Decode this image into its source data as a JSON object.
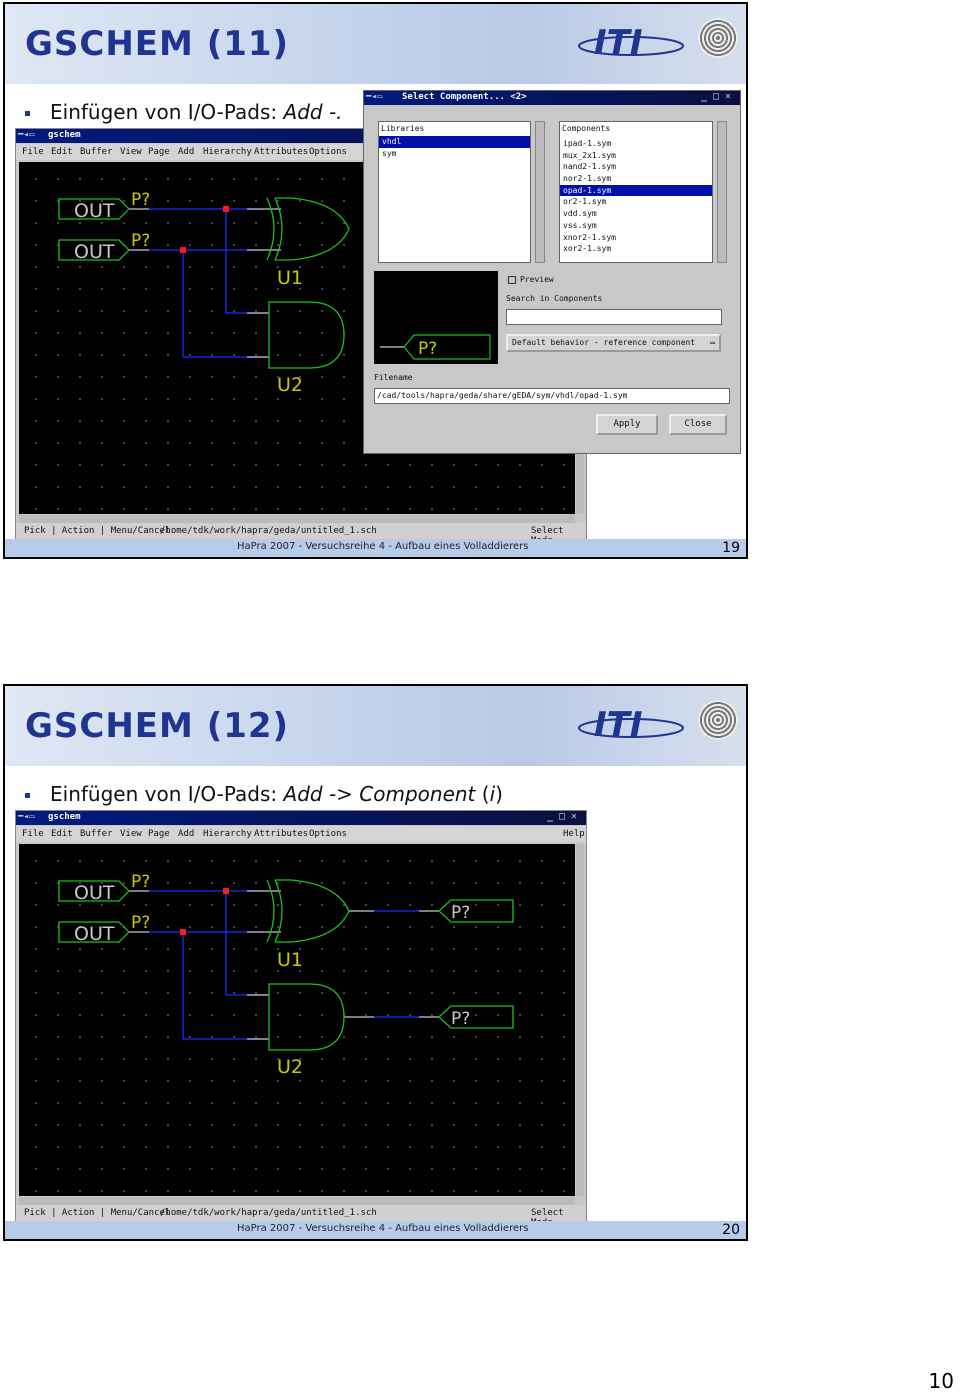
{
  "slides": [
    {
      "title": "GSCHEM (11)",
      "bullet": {
        "text": "Einfügen von I/O-Pads: ",
        "italic": "Add -."
      },
      "footer": "HaPra 2007 - Versuchsreihe 4 - Aufbau eines Volladdierers",
      "page": "19"
    },
    {
      "title": "GSCHEM (12)",
      "bullet": {
        "text": "Einfügen von I/O-Pads: ",
        "italic": "Add -> Component",
        "suffix": " (",
        "suffix_italic": "i",
        "suffix_end": ")"
      },
      "footer": "HaPra 2007 - Versuchsreihe 4 - Aufbau eines Volladdierers",
      "page": "20"
    }
  ],
  "logo": {
    "text": "ITI"
  },
  "gschem": {
    "title": "gschem",
    "menu": [
      "File",
      "Edit",
      "Buffer",
      "View",
      "Page",
      "Add",
      "Hierarchy",
      "Attributes",
      "Options",
      "Help"
    ],
    "status_left": "Pick  | Action  | Menu/Cancel",
    "status_path": "/home/tdk/work/hapra/geda/untitled_1.sch",
    "status_mode": "Select Mode",
    "pad_out": "OUT",
    "pad_p": "P?",
    "gate_u1": "U1",
    "gate_u2": "U2"
  },
  "dialog": {
    "title": "Select Component... <2>",
    "libraries_label": "Libraries",
    "libraries": [
      "vhdl",
      "sym"
    ],
    "selected_library": "vhdl",
    "components_label": "Components",
    "components": [
      "ipad-1.sym",
      "mux_2x1.sym",
      "nand2-1.sym",
      "nor2-1.sym",
      "opad-1.sym",
      "or2-1.sym",
      "vdd.sym",
      "vss.sym",
      "xnor2-1.sym",
      "xor2-1.sym"
    ],
    "selected_component": "opad-1.sym",
    "preview_label": "Preview",
    "search_label": "Search in Components",
    "search_value": "",
    "behavior": "Default behavior - reference component",
    "filename_label": "Filename",
    "filename": "/cad/tools/hapra/geda/share/gEDA/sym/vhdl/opad-1.sym",
    "apply": "Apply",
    "close": "Close",
    "preview_pad": "P?"
  },
  "document_page": "10",
  "colors": {
    "title": "#1f3590",
    "wire": "#1a2cff",
    "symbol": "#19c119",
    "pin": "#c8c8c8",
    "junction": "#ff1a1a",
    "label": "#c8c800"
  }
}
